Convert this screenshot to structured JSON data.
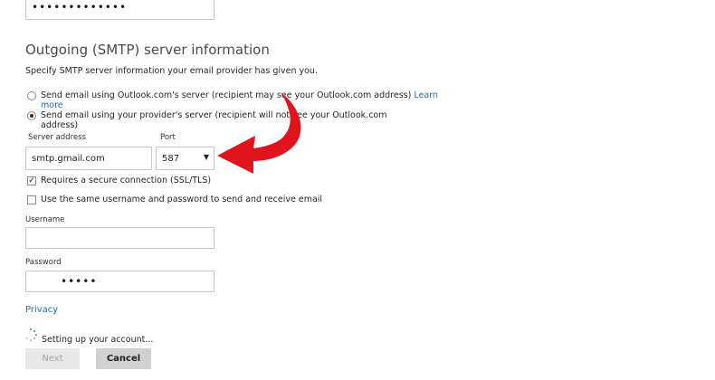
{
  "top_password": {
    "value": "•••••••••••••"
  },
  "section": {
    "title": "Outgoing (SMTP) server information",
    "description": "Specify SMTP server information your email provider has given you."
  },
  "options": {
    "outlook_server": {
      "label": "Send email using Outlook.com's server (recipient may see your Outlook.com address)",
      "link": "Learn more",
      "selected": false
    },
    "provider_server": {
      "label": "Send email using your provider's server (recipient will not see your Outlook.com address)",
      "selected": true
    }
  },
  "server": {
    "label": "Server address",
    "value": "smtp.gmail.com"
  },
  "port": {
    "label": "Port",
    "value": "587"
  },
  "checkboxes": {
    "secure": {
      "label": "Requires a secure connection (SSL/TLS)",
      "checked": true
    },
    "same_credentials": {
      "label": "Use the same username and password to send and receive email",
      "checked": false
    }
  },
  "username": {
    "label": "Username",
    "value": ""
  },
  "password": {
    "label": "Password",
    "value": "•••••"
  },
  "privacy_link": "Privacy",
  "status": {
    "text": "Setting up your account..."
  },
  "buttons": {
    "next": "Next",
    "cancel": "Cancel"
  },
  "colors": {
    "link": "#1a6fb4",
    "annotation_arrow": "#e0141c",
    "cancel_bg": "#d1d1d1",
    "next_bg": "#e8e8e8"
  },
  "icons": {
    "arrow_annotation": "red-curved-arrow-icon",
    "spinner": "loading-spinner-icon",
    "port_dropdown": "dropdown-caret-icon"
  }
}
